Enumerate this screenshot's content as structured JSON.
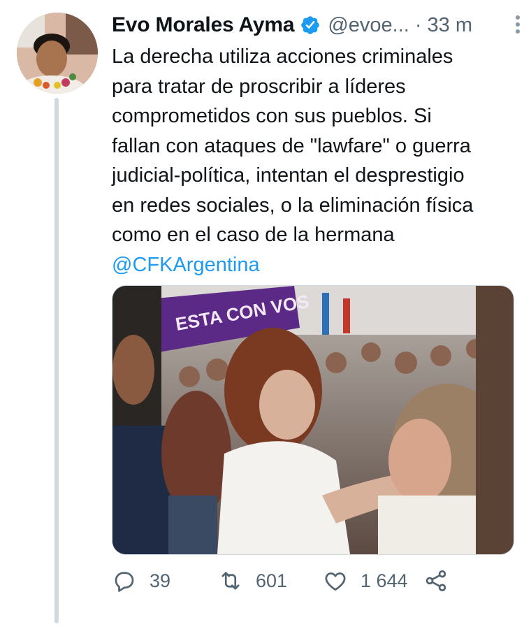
{
  "tweet": {
    "author_name": "Evo Morales Ayma",
    "author_handle": "@evoe...",
    "separator": "·",
    "time": "33 m",
    "text_lines": [
      "La derecha utiliza acciones criminales",
      "para tratar de proscribir a líderes",
      "comprometidos con sus pueblos. Si",
      "fallan con ataques de \"lawfare\" o guerra",
      "judicial-política, intentan el desprestigio",
      "en redes sociales, o la eliminación física",
      "como en el caso de la hermana"
    ],
    "mention": "@CFKArgentina",
    "banner_text": "ESTA CON VOS",
    "colors": {
      "verified": "#1d9bf0",
      "link": "#1d9bf0",
      "muted": "#536471"
    },
    "icons": {
      "reply": "speech-bubble-icon",
      "retweet": "retweet-arrows-icon",
      "like": "heart-icon",
      "share": "share-icon",
      "more": "vertical-ellipsis-icon"
    }
  },
  "actions": {
    "replies": "39",
    "retweets": "601",
    "likes": "1 644"
  }
}
